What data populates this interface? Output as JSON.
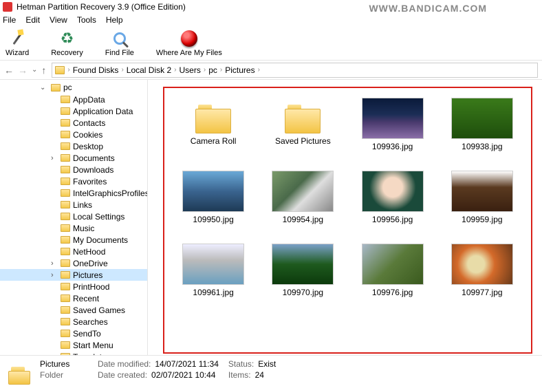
{
  "title": "Hetman Partition Recovery 3.9 (Office Edition)",
  "watermark": "WWW.BANDICAM.COM",
  "menu": [
    "File",
    "Edit",
    "View",
    "Tools",
    "Help"
  ],
  "toolbar": {
    "wizard": "Wizard",
    "recovery": "Recovery",
    "find": "Find File",
    "where": "Where Are My Files"
  },
  "breadcrumb": [
    "Found Disks",
    "Local Disk 2",
    "Users",
    "pc",
    "Pictures"
  ],
  "tree": {
    "root": "pc",
    "items": [
      {
        "label": "AppData"
      },
      {
        "label": "Application Data"
      },
      {
        "label": "Contacts"
      },
      {
        "label": "Cookies"
      },
      {
        "label": "Desktop"
      },
      {
        "label": "Documents",
        "hasChildren": true
      },
      {
        "label": "Downloads"
      },
      {
        "label": "Favorites"
      },
      {
        "label": "IntelGraphicsProfiles"
      },
      {
        "label": "Links"
      },
      {
        "label": "Local Settings"
      },
      {
        "label": "Music"
      },
      {
        "label": "My Documents"
      },
      {
        "label": "NetHood"
      },
      {
        "label": "OneDrive",
        "hasChildren": true
      },
      {
        "label": "Pictures",
        "hasChildren": true,
        "selected": true
      },
      {
        "label": "PrintHood"
      },
      {
        "label": "Recent"
      },
      {
        "label": "Saved Games"
      },
      {
        "label": "Searches"
      },
      {
        "label": "SendTo"
      },
      {
        "label": "Start Menu"
      },
      {
        "label": "Templates"
      }
    ]
  },
  "grid": [
    {
      "type": "folder",
      "name": "Camera Roll"
    },
    {
      "type": "folder",
      "name": "Saved Pictures"
    },
    {
      "type": "img",
      "name": "109936.jpg",
      "bg": "linear-gradient(180deg,#0a1a3a 0%,#1b2d55 40%,#4a3a6e 60%,#8b6fa8 100%)"
    },
    {
      "type": "img",
      "name": "109938.jpg",
      "bg": "linear-gradient(180deg,#3a7a1a 0%,#1e4e0c 100%)"
    },
    {
      "type": "img",
      "name": "109950.jpg",
      "bg": "linear-gradient(180deg,#6aa8d6 0%,#3a648f 50%,#1e3a55 100%)"
    },
    {
      "type": "img",
      "name": "109954.jpg",
      "bg": "linear-gradient(135deg,#7a9a6a 0%,#4a6a4a 40%,#dedede 60%,#888 100%)"
    },
    {
      "type": "img",
      "name": "109956.jpg",
      "bg": "radial-gradient(circle at 50% 40%,#f5d9c4 25%,#1a4a3a 60%)"
    },
    {
      "type": "img",
      "name": "109959.jpg",
      "bg": "linear-gradient(180deg,#fff 0%,#5a3a20 40%,#3a2010 100%)"
    },
    {
      "type": "img",
      "name": "109961.jpg",
      "bg": "linear-gradient(180deg,#eef 0%,#bbb 40%,#6aa0c0 100%)"
    },
    {
      "type": "img",
      "name": "109970.jpg",
      "bg": "linear-gradient(180deg,#7aa0c8 0%,#1e5a1e 50%,#0c3a0c 100%)"
    },
    {
      "type": "img",
      "name": "109976.jpg",
      "bg": "linear-gradient(135deg,#a8b8c8 0%,#5a7a3a 50%,#3a5a1e 100%)"
    },
    {
      "type": "img",
      "name": "109977.jpg",
      "bg": "radial-gradient(circle at 40% 50%,#e8dca8 20%,#d46a2a 45%,#6a3a1a 100%)"
    }
  ],
  "status": {
    "name": "Pictures",
    "type": "Folder",
    "modified_label": "Date modified:",
    "modified": "14/07/2021 11:34",
    "created_label": "Date created:",
    "created": "02/07/2021 10:44",
    "status_label": "Status:",
    "status": "Exist",
    "items_label": "Items:",
    "items": "24"
  }
}
